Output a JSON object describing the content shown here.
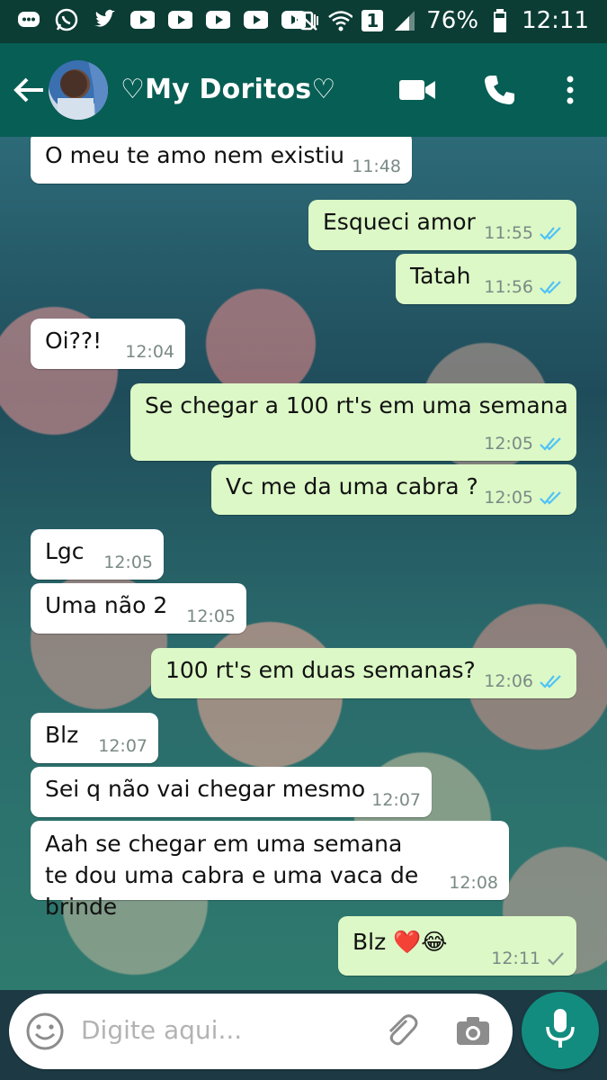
{
  "status_bar": {
    "battery": "76%",
    "time": "12:11",
    "sim": "1",
    "icons": [
      "messenger-icon",
      "whatsapp-icon",
      "twitter-icon",
      "youtube-icon",
      "youtube-icon",
      "youtube-icon",
      "youtube-icon",
      "youtube-icon",
      "mute-vibrate-icon",
      "wifi-icon",
      "signal-icon",
      "battery-icon"
    ]
  },
  "header": {
    "contact_name": "♡My Doritos♡",
    "icons": [
      "back-arrow-icon",
      "video-call-icon",
      "phone-icon",
      "more-vert-icon"
    ]
  },
  "messages": [
    {
      "dir": "in",
      "text": "O meu te amo nem existiu",
      "time": "11:48",
      "ticks": ""
    },
    {
      "dir": "out",
      "text": "Esqueci amor",
      "time": "11:55",
      "ticks": "double-blue"
    },
    {
      "dir": "out",
      "text": "Tatah",
      "time": "11:56",
      "ticks": "double-blue"
    },
    {
      "dir": "in",
      "text": "Oi??!",
      "time": "12:04",
      "ticks": ""
    },
    {
      "dir": "out",
      "text": "Se chegar a 100 rt's em uma semana",
      "time": "12:05",
      "ticks": "double-blue"
    },
    {
      "dir": "out",
      "text": "Vc me da uma cabra ?",
      "time": "12:05",
      "ticks": "double-blue"
    },
    {
      "dir": "in",
      "text": "Lgc",
      "time": "12:05",
      "ticks": ""
    },
    {
      "dir": "in",
      "text": "Uma não 2",
      "time": "12:05",
      "ticks": ""
    },
    {
      "dir": "out",
      "text": "100 rt's em duas semanas?",
      "time": "12:06",
      "ticks": "double-blue"
    },
    {
      "dir": "in",
      "text": "Blz",
      "time": "12:07",
      "ticks": ""
    },
    {
      "dir": "in",
      "text": "Sei q não vai chegar mesmo",
      "time": "12:07",
      "ticks": ""
    },
    {
      "dir": "in",
      "text": "Aah se chegar em uma semana te dou uma cabra e uma vaca de brinde",
      "time": "12:08",
      "ticks": ""
    },
    {
      "dir": "out",
      "text": "Blz ❤️😂",
      "time": "12:11",
      "ticks": "single-grey"
    }
  ],
  "input": {
    "placeholder": "Digite aqui...",
    "icons": [
      "emoji-icon",
      "attach-icon",
      "camera-icon",
      "mic-icon"
    ]
  },
  "colors": {
    "status_bar": "#0b3d35",
    "app_bar": "#075e54",
    "incoming_bubble": "#ffffff",
    "outgoing_bubble": "#dcf8c6",
    "read_ticks": "#4fc3f7",
    "mic_button": "#128c7e"
  }
}
